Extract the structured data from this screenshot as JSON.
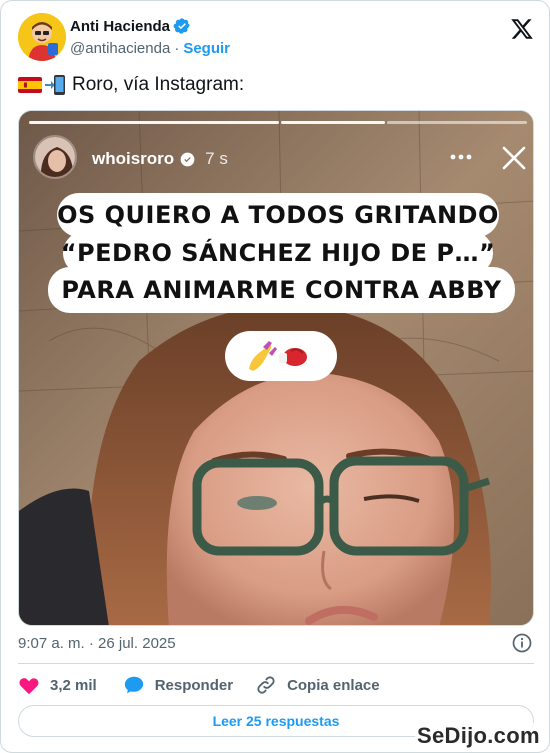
{
  "author": {
    "display_name": "Anti Hacienda",
    "handle": "@antihacienda",
    "separator": "·",
    "follow_label": "Seguir"
  },
  "tweet": {
    "text": "Roro, vía Instagram:",
    "emojis": [
      "flag-spain-icon",
      "phone-arrow-icon"
    ]
  },
  "story": {
    "username": "whoisroro",
    "time_ago": "7 s",
    "caption_lines": [
      "OS QUIERO A TODOS GRITANDO",
      "“PEDRO SÁNCHEZ HIJO DE P…”",
      "PARA ANIMARME CONTRA ABBY"
    ],
    "sticker_icons": [
      "nail-polish-icon",
      "boxing-glove-icon"
    ]
  },
  "meta": {
    "timestamp": "9:07 a. m. · 26 jul. 2025"
  },
  "actions": {
    "likes": "3,2 mil",
    "reply_label": "Responder",
    "copy_label": "Copia enlace"
  },
  "read_replies_label": "Leer 25 respuestas",
  "watermark": "SeDijo.com",
  "colors": {
    "accent": "#1d9bf0",
    "like": "#f91880",
    "text_secondary": "#536471",
    "border": "#cfd9de"
  }
}
